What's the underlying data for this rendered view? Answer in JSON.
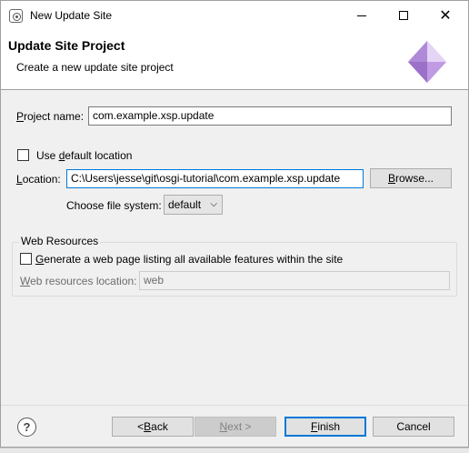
{
  "window": {
    "title": "New Update Site"
  },
  "header": {
    "title": "Update Site Project",
    "subtitle": "Create a new update site project"
  },
  "form": {
    "project_name": {
      "label_pre": "",
      "label_u": "P",
      "label_post": "roject name:",
      "value": "com.example.xsp.update"
    },
    "use_default": {
      "label_pre": "Use ",
      "label_u": "d",
      "label_post": "efault location",
      "checked": false
    },
    "location": {
      "label_pre": "",
      "label_u": "L",
      "label_post": "ocation:",
      "value": "C:\\Users\\jesse\\git\\osgi-tutorial\\com.example.xsp.update"
    },
    "browse": {
      "label_pre": "",
      "label_u": "B",
      "label_post": "rowse..."
    },
    "file_system": {
      "label": "Choose file system:",
      "selected": "default"
    }
  },
  "web_resources": {
    "group_title": "Web Resources",
    "generate": {
      "label_pre": "",
      "label_u": "G",
      "label_post": "enerate a web page listing all available features within the site",
      "checked": false
    },
    "location": {
      "label_pre": "",
      "label_u": "W",
      "label_post": "eb resources location:",
      "value": "web"
    }
  },
  "footer": {
    "help": "?",
    "back": {
      "label_pre": "< ",
      "label_u": "B",
      "label_post": "ack"
    },
    "next": {
      "label_pre": "",
      "label_u": "N",
      "label_post": "ext >"
    },
    "finish": {
      "label_pre": "",
      "label_u": "F",
      "label_post": "inish"
    },
    "cancel": "Cancel"
  },
  "colors": {
    "accent": "#0078d7",
    "dialog_bg": "#f0f0f0",
    "banner_bg": "#ffffff"
  }
}
